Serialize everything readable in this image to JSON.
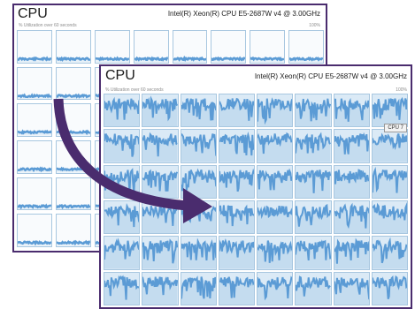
{
  "colors": {
    "frame": "#4a2c6e",
    "arrow": "#4a2c6e",
    "graph_line": "#5b9bd5",
    "graph_fill": "#dbeaf6",
    "grid_border": "#a8c7e0"
  },
  "back_window": {
    "title": "CPU",
    "cpu_name": "Intel(R) Xeon(R) CPU E5-2687W v4 @ 3.00GHz",
    "caption": "% Utilization over 60 seconds",
    "max_label": "100%"
  },
  "front_window": {
    "title": "CPU",
    "cpu_name": "Intel(R) Xeon(R) CPU E5-2687W v4 @ 3.00GHz",
    "caption": "% Utilization over 60 seconds",
    "max_label": "100%",
    "tooltip": "CPU 7"
  },
  "arrow_icon": "curved-arrow-right"
}
